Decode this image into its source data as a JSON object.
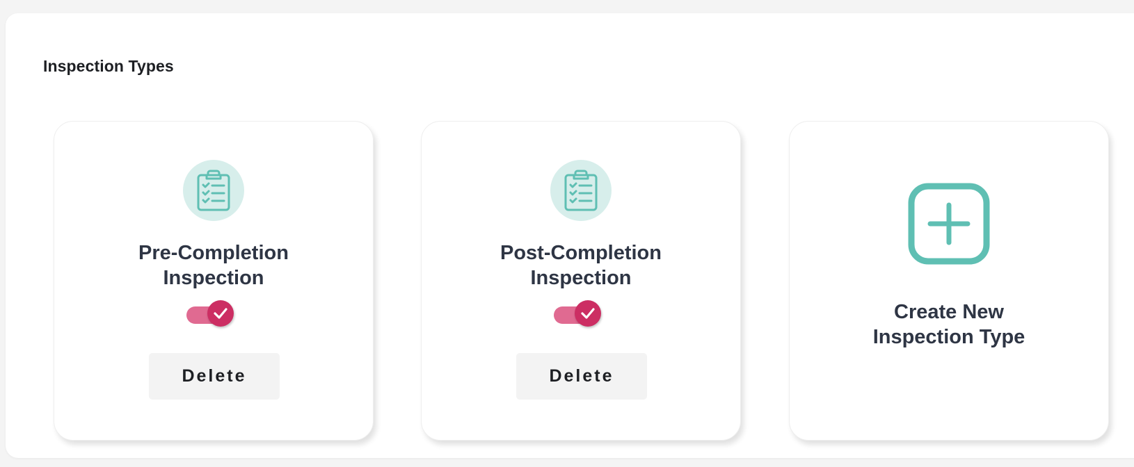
{
  "section": {
    "title": "Inspection Types"
  },
  "cards": [
    {
      "title": "Pre-Completion\nInspection",
      "icon": "clipboard-checklist-icon",
      "enabled": true,
      "delete_label": "Delete"
    },
    {
      "title": "Post-Completion\nInspection",
      "icon": "clipboard-checklist-icon",
      "enabled": true,
      "delete_label": "Delete"
    }
  ],
  "create": {
    "title": "Create New\nInspection Type",
    "icon": "plus-square-icon"
  },
  "colors": {
    "accent_teal": "#5fbfb3",
    "icon_bg": "#d7eeeb",
    "toggle_track": "#e06a91",
    "toggle_knob": "#cc2e63",
    "text_dark": "#2e3544",
    "page_bg": "#f4f4f4"
  }
}
